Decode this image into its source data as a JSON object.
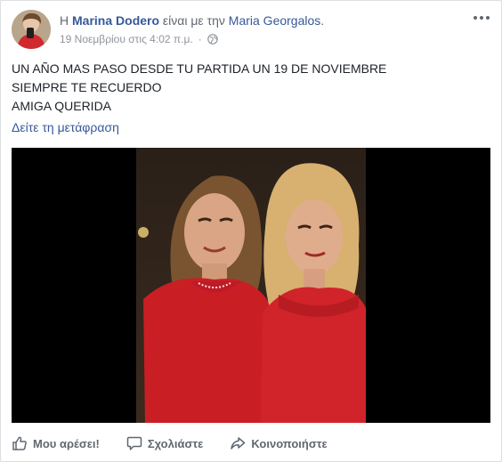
{
  "post": {
    "author": {
      "prefix": "Η",
      "name": "Marina Dodero",
      "with_text": "είναι με την",
      "tagged_name": "Maria Georgalos",
      "period": "."
    },
    "timestamp": "19 Νοεμβρίου στις 4:02 π.μ.",
    "separator": "·",
    "privacy_icon": "globe-icon",
    "text_lines": [
      "UN AÑO MAS PASO DESDE TU PARTIDA UN 19 DE NOVIEMBRE",
      "SIEMPRE TE RECUERDO",
      "AMIGA QUERIDA"
    ],
    "translate_link": "Δείτε τη μετάφραση"
  },
  "actions": {
    "like": "Μου αρέσει!",
    "comment": "Σχολιάστε",
    "share": "Κοινοποιήστε"
  },
  "colors": {
    "link": "#365899",
    "muted": "#90949c",
    "action": "#606770",
    "media_bg": "#000000"
  }
}
